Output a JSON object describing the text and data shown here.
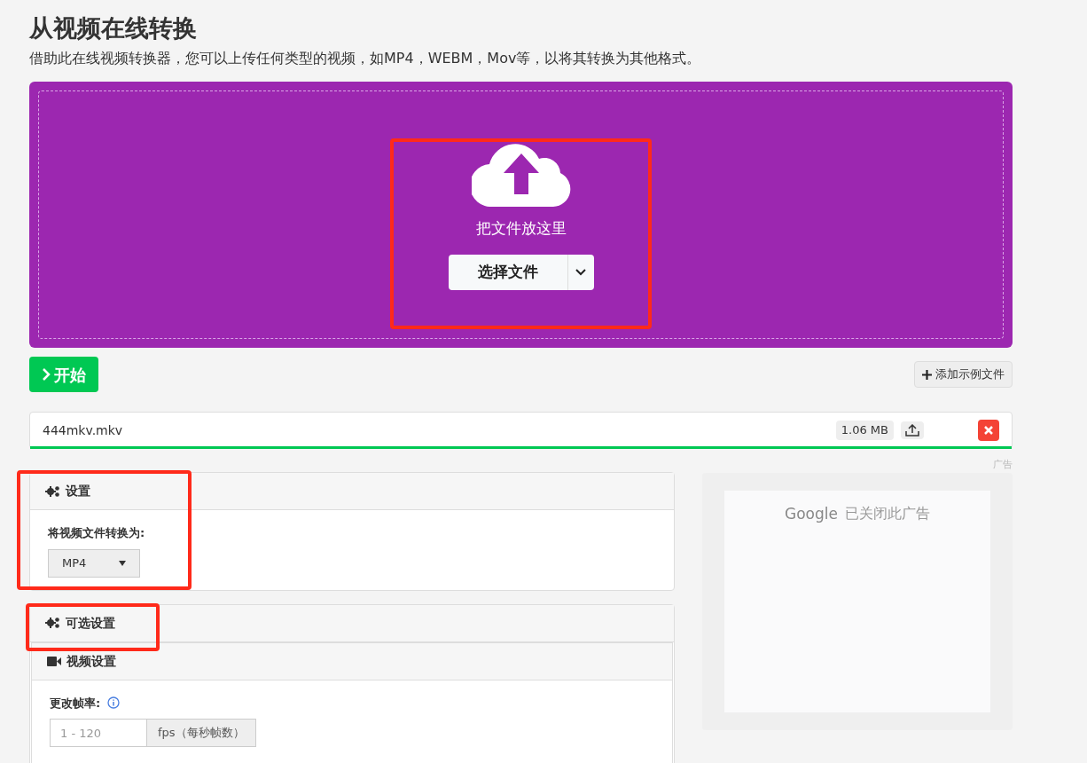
{
  "title": "从视频在线转换",
  "subtitle": "借助此在线视频转换器，您可以上传任何类型的视频，如MP4，WEBM，Mov等，以将其转换为其他格式。",
  "dropzone": {
    "hint": "把文件放这里",
    "button": "选择文件",
    "highlighted": true
  },
  "start_button": "开始",
  "add_example_button": "添加示例文件",
  "file": {
    "name": "444mkv.mkv",
    "size": "1.06 MB",
    "level": 1
  },
  "ad_label": "广告",
  "ad": {
    "brand": "Google",
    "message": "已关闭此广告"
  },
  "settings": {
    "title": "设置",
    "highlighted": true,
    "label": "将视频文件转换为:",
    "format": "MP4"
  },
  "optional_settings": {
    "title": "可选设置",
    "highlighted": true,
    "video": {
      "title": "视频设置",
      "label": "更改帧率:",
      "placeholder": "1 - 120",
      "unit": "fps（每秒帧数）"
    }
  }
}
